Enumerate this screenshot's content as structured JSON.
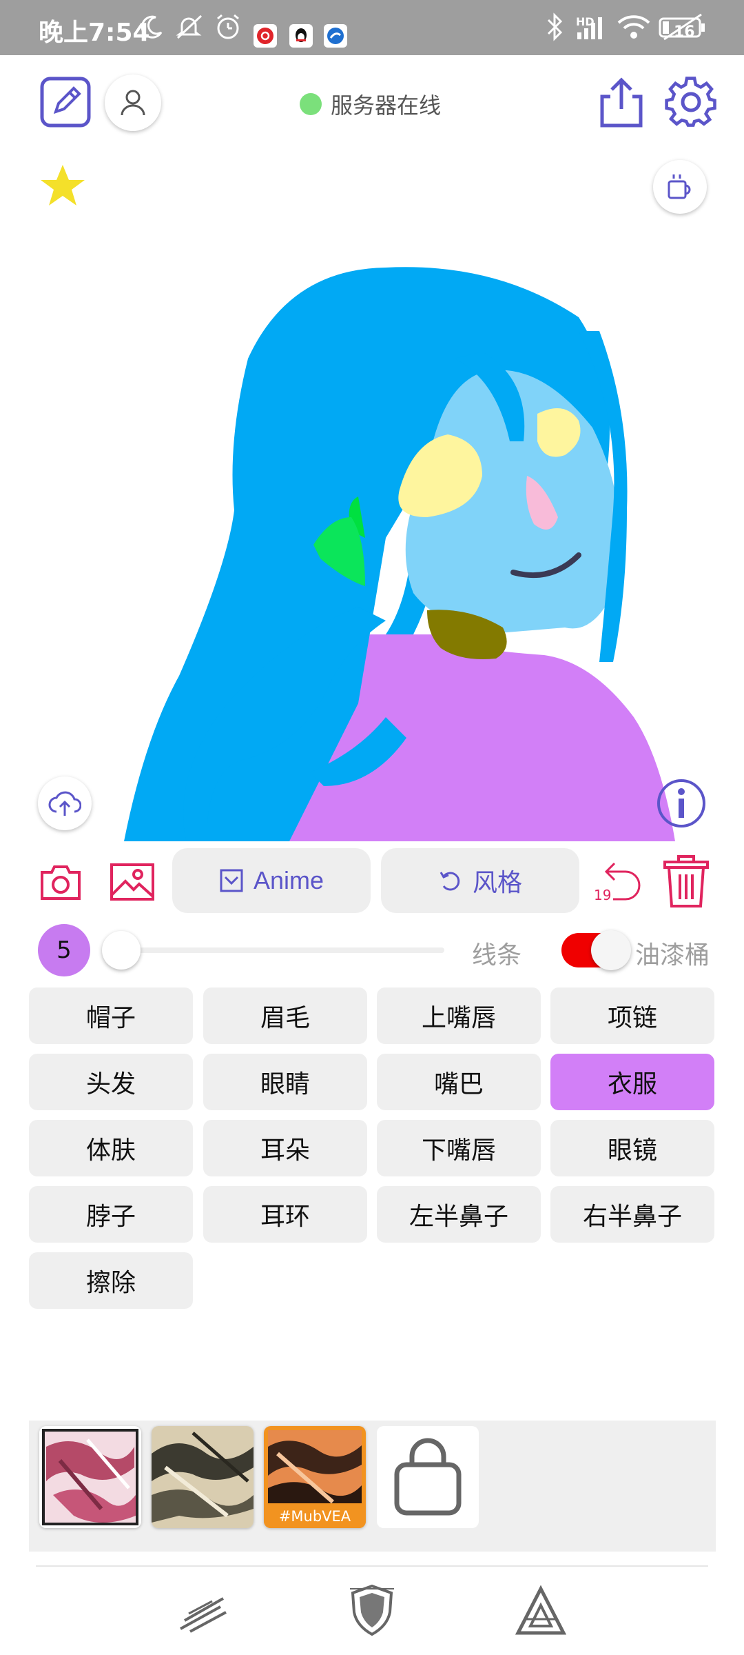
{
  "status_bar": {
    "time": "晚上7:54",
    "battery": "16",
    "network": "HD",
    "icons": [
      "moon-icon",
      "mute-icon",
      "alarm-icon",
      "netease-icon",
      "qq-icon",
      "app-icon",
      "bluetooth-icon",
      "signal-icon",
      "wifi-icon",
      "battery-icon"
    ]
  },
  "header": {
    "server_status": "服务器在线",
    "server_status_color": "#7be07b",
    "accent": "#5b55c9"
  },
  "tools": {
    "anime_label": "Anime",
    "style_label": "风格",
    "undo_count": "19",
    "accent_red": "#e0245e"
  },
  "brush": {
    "size": "5",
    "slider_level": 0.0,
    "line_label": "线条",
    "bucket_label": "油漆桶",
    "bucket_enabled": true
  },
  "parts": [
    {
      "label": "帽子",
      "selected": false
    },
    {
      "label": "眉毛",
      "selected": false
    },
    {
      "label": "上嘴唇",
      "selected": false
    },
    {
      "label": "项链",
      "selected": false
    },
    {
      "label": "头发",
      "selected": false
    },
    {
      "label": "眼睛",
      "selected": false
    },
    {
      "label": "嘴巴",
      "selected": false
    },
    {
      "label": "衣服",
      "selected": true
    },
    {
      "label": "体肤",
      "selected": false
    },
    {
      "label": "耳朵",
      "selected": false
    },
    {
      "label": "下嘴唇",
      "selected": false
    },
    {
      "label": "眼镜",
      "selected": false
    },
    {
      "label": "脖子",
      "selected": false
    },
    {
      "label": "耳环",
      "selected": false
    },
    {
      "label": "左半鼻子",
      "selected": false
    },
    {
      "label": "右半鼻子",
      "selected": false
    },
    {
      "label": "擦除",
      "selected": false
    }
  ],
  "thumbnails": [
    {
      "tag": ""
    },
    {
      "tag": ""
    },
    {
      "tag": "#MubVEA"
    }
  ],
  "selected_color": "#d27ff7"
}
